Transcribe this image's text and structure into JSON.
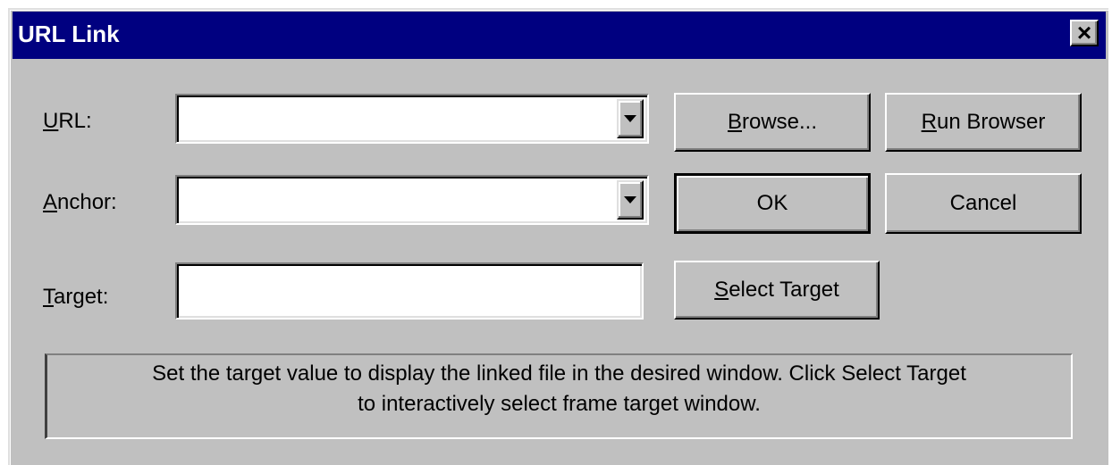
{
  "window": {
    "title": "URL Link",
    "close_glyph": "×"
  },
  "colors": {
    "titlebar": "#000080",
    "face": "#c0c0c0"
  },
  "url": {
    "label_mnemonic": "U",
    "label_rest": "RL:",
    "value": ""
  },
  "anchor": {
    "label_mnemonic": "A",
    "label_rest": "nchor:",
    "value": ""
  },
  "target": {
    "label_mnemonic": "T",
    "label_rest": "arget:",
    "value": ""
  },
  "buttons": {
    "browse_mnemonic": "B",
    "browse_rest": "rowse...",
    "run_browser_mnemonic": "R",
    "run_browser_rest": "un Browser",
    "ok": "OK",
    "cancel": "Cancel",
    "select_target_mnemonic": "S",
    "select_target_rest": "elect Target"
  },
  "help_text": {
    "line1": "Set the target value to display the linked file in the desired window. Click Select Target",
    "line2": "to interactively select frame target window."
  },
  "icons": {
    "close": "close-icon",
    "dropdown": "chevron-down-icon"
  }
}
